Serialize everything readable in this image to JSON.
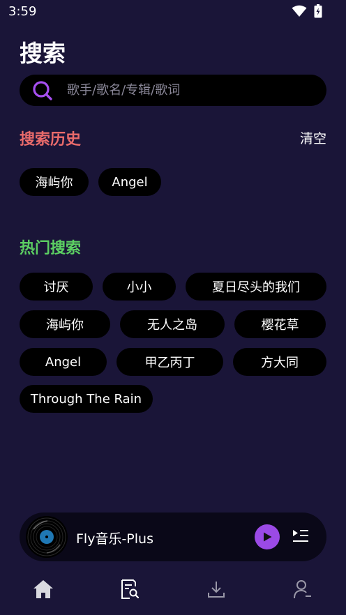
{
  "status_bar": {
    "time": "3:59"
  },
  "page_title": "搜索",
  "search": {
    "placeholder": "歌手/歌名/专辑/歌词",
    "value": ""
  },
  "history": {
    "title": "搜索历史",
    "title_color": "#e96b6b",
    "clear_label": "清空",
    "items": [
      "海屿你",
      "Angel"
    ]
  },
  "hot": {
    "title": "热门搜索",
    "title_color": "#5ccf62",
    "items": [
      "讨厌",
      "小小",
      "夏日尽头的我们",
      "海屿你",
      "无人之岛",
      "樱花草",
      "Angel",
      "甲乙丙丁",
      "方大同",
      "Through The Rain"
    ]
  },
  "player": {
    "title": "Fly音乐-Plus",
    "accent_color": "#9b4ae6"
  },
  "bottom_nav": {
    "items": [
      "home-icon",
      "search-list-icon",
      "download-icon",
      "user-icon"
    ],
    "active_index": 1
  }
}
